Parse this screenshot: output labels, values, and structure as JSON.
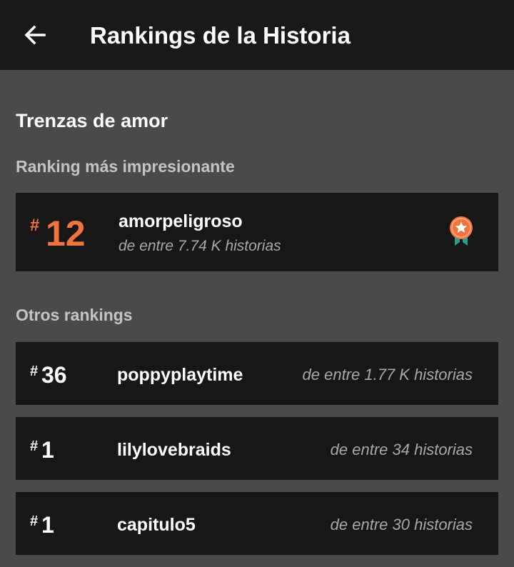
{
  "header": {
    "title": "Rankings de la Historia",
    "back_icon": "arrow-left-icon"
  },
  "story": {
    "title": "Trenzas de amor"
  },
  "best_ranking": {
    "section_label": "Ranking más impresionante",
    "hash": "#",
    "rank": "12",
    "tag": "amorpeligroso",
    "subtitle": "de entre 7.74 K historias",
    "badge_icon": "medal-star-icon",
    "accent_color": "#f0743c"
  },
  "other_rankings": {
    "section_label": "Otros rankings",
    "items": [
      {
        "hash": "#",
        "rank": "36",
        "tag": "poppyplaytime",
        "subtitle": "de entre 1.77 K historias"
      },
      {
        "hash": "#",
        "rank": "1",
        "tag": "lilylovebraids",
        "subtitle": "de entre 34 historias"
      },
      {
        "hash": "#",
        "rank": "1",
        "tag": "capitulo5",
        "subtitle": "de entre 30 historias"
      }
    ]
  }
}
